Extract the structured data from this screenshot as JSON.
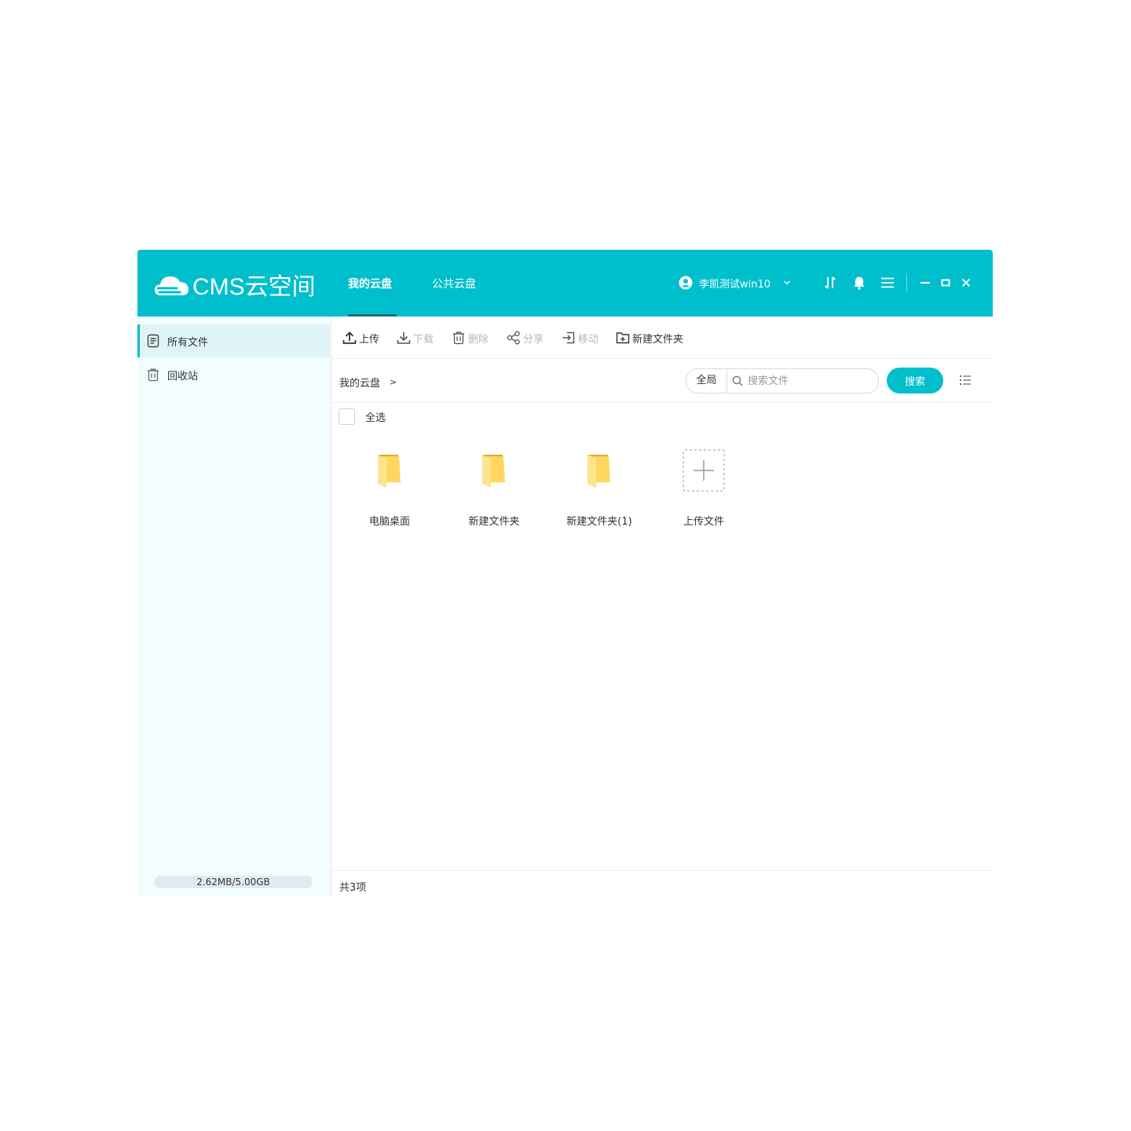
{
  "app": {
    "logo_text": "CMS云空间"
  },
  "nav": {
    "tabs": [
      {
        "label": "我的云盘",
        "active": true
      },
      {
        "label": "公共云盘",
        "active": false
      }
    ]
  },
  "user": {
    "name": "李凯测试win10"
  },
  "sidebar": {
    "items": [
      {
        "label": "所有文件",
        "icon": "document-icon",
        "active": true
      },
      {
        "label": "回收站",
        "icon": "trash-icon",
        "active": false
      }
    ],
    "storage": {
      "text": "2.62MB/5.00GB"
    }
  },
  "toolbar": {
    "upload": "上传",
    "download": "下载",
    "delete": "删除",
    "share": "分享",
    "move": "移动",
    "new_folder": "新建文件夹"
  },
  "breadcrumb": {
    "root": "我的云盘",
    "separator": ">"
  },
  "search": {
    "scope": "全局",
    "placeholder": "搜索文件",
    "button": "搜索"
  },
  "select_all": "全选",
  "files": [
    {
      "name": "电脑桌面",
      "type": "folder"
    },
    {
      "name": "新建文件夹",
      "type": "folder"
    },
    {
      "name": "新建文件夹(1)",
      "type": "folder"
    }
  ],
  "upload_tile": {
    "label": "上传文件"
  },
  "status": {
    "count": "共3项"
  },
  "colors": {
    "accent": "#00bfcc",
    "sidebar_bg": "#f1fdff",
    "folder": "#ffd65e"
  }
}
